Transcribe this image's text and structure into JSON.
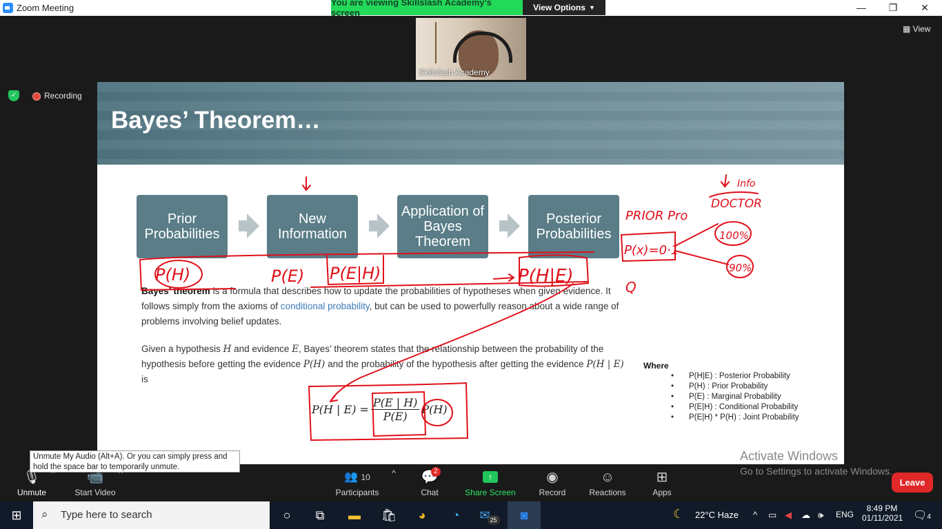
{
  "window": {
    "title": "Zoom Meeting",
    "banner": "You are viewing Skillslash Academy's screen",
    "view_options": "View Options",
    "controls": {
      "minimize": "—",
      "restore": "❐",
      "close": "✕"
    }
  },
  "meeting": {
    "participant_name": "Skillslash Academy",
    "view_label": "View",
    "recording_label": "Recording"
  },
  "slide": {
    "title": "Bayes’ Theorem…",
    "flow": [
      "Prior Probabilities",
      "New Information",
      "Application of Bayes Theorem",
      "Posterior Probabilities"
    ],
    "para1": {
      "bold": "Bayes’ theorem",
      "text1": " is a formula that describes how to update the probabilities of hypotheses when given evidence. It follows simply from the axioms of ",
      "link": "conditional probability",
      "text2": ", but can be used to powerfully reason about a wide range of problems involving belief updates."
    },
    "para2": {
      "t1": "Given a hypothesis ",
      "H": "H",
      "t2": " and evidence ",
      "E": "E",
      "t3": ", Bayes’ theorem states that the relationship between the probability of the hypothesis before getting the evidence ",
      "PH": "P(H)",
      "t4": " and the probability of the hypothesis after getting the evidence ",
      "PHE": "P(H | E)",
      "t5": " is"
    },
    "formula": {
      "lhs": "P(H | E) =",
      "numerator": "P(E | H)",
      "denominator": "P(E)",
      "tail": "P(H)"
    },
    "where_label": "Where",
    "where_items": [
      "P(H|E) : Posterior Probability",
      "P(H) : Prior Probability",
      "P(E) : Marginal Probability",
      "P(E|H) : Conditional Probability",
      "P(E|H) * P(H) : Joint Probability"
    ],
    "annotations": {
      "ph": "P(H)",
      "pe": "P(E)",
      "peh": "P(E|H)",
      "phe": "P(H|E)",
      "prior": "PRIOR Pro",
      "px": "P(x)=0·1",
      "doctor": "DOCTOR",
      "info": "Info",
      "hundred": "100%",
      "ninety": "90%",
      "q": "Q"
    }
  },
  "tooltip": "Unmute My Audio (Alt+A). Or you can simply press and hold the space bar to temporarily unmute.",
  "toolbar": {
    "unmute": "Unmute",
    "start_video": "Start Video",
    "participants_count": "10",
    "participants": "Participants",
    "chat": "Chat",
    "chat_badge": "2",
    "share_screen": "Share Screen",
    "record": "Record",
    "reactions": "Reactions",
    "apps": "Apps",
    "leave": "Leave"
  },
  "watermark": {
    "line1": "Activate Windows",
    "line2": "Go to Settings to activate Windows."
  },
  "taskbar": {
    "search_placeholder": "Type here to search",
    "weather": "22°C  Haze",
    "lang": "ENG",
    "time": "8:49 PM",
    "date": "01/11/2021",
    "mail_badge": "25",
    "notif_count": "4"
  }
}
